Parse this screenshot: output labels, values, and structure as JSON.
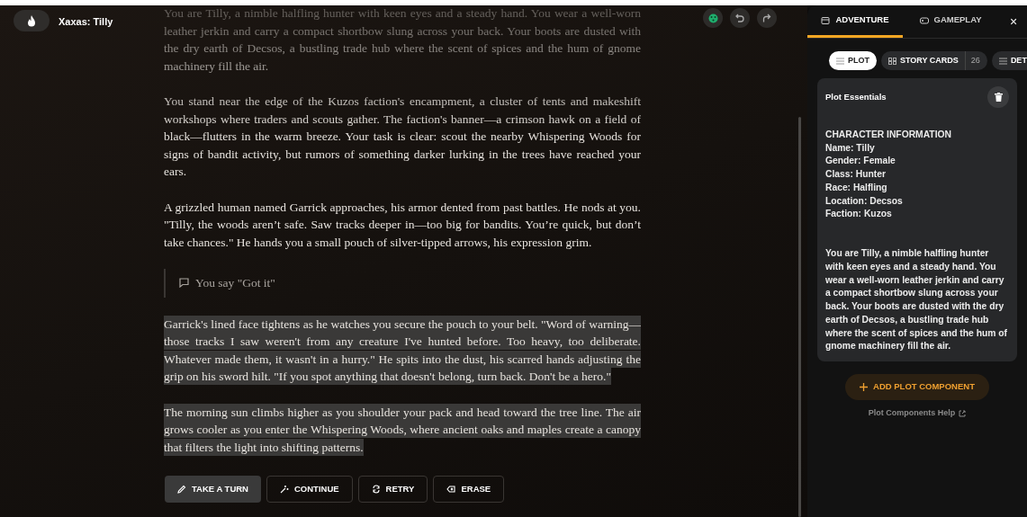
{
  "header": {
    "title": "Xaxas: Tilly"
  },
  "story": [
    {
      "kind": "narration",
      "highlighted": false,
      "text": "You are Tilly, a nimble halfling hunter with keen eyes and a steady hand. You wear a well-worn leather jerkin and carry a compact shortbow slung across your back. Your boots are dusted with the dry earth of Decsos, a bustling trade hub where the scent of spices and the hum of gnome machinery fill the air."
    },
    {
      "kind": "narration",
      "highlighted": false,
      "text": "You stand near the edge of the Kuzos faction's encampment, a cluster of tents and makeshift workshops where traders and scouts gather. The faction's banner—a crimson hawk on a field of black—flutters in the warm breeze. Your task is clear: scout the nearby Whispering Woods for signs of bandit activity, but rumors of something darker lurking in the trees have reached your ears."
    },
    {
      "kind": "narration",
      "highlighted": false,
      "text": "A grizzled human named Garrick approaches, his armor dented from past battles. He nods at you. \"Tilly, the woods aren’t safe. Saw tracks deeper in—too big for bandits. You’re quick, but don’t take chances.\" He hands you a small pouch of silver-tipped arrows, his expression grim."
    },
    {
      "kind": "action",
      "highlighted": false,
      "text": "You say \"Got it\""
    },
    {
      "kind": "narration",
      "highlighted": true,
      "text": "Garrick's lined face tightens as he watches you secure the pouch to your belt. \"Word of warning—those tracks I saw weren't from any creature I've hunted before. Too heavy, too deliberate. Whatever made them, it wasn't in a hurry.\" He spits into the dust, his scarred hands adjusting the grip on his sword hilt. \"If you spot anything that doesn't belong, turn back. Don't be a hero.\""
    },
    {
      "kind": "narration",
      "highlighted": true,
      "text": "The morning sun climbs higher as you shoulder your pack and head toward the tree line. The air grows cooler as you enter the Whispering Woods, where ancient oaks and maples create a canopy that filters the light into shifting patterns."
    }
  ],
  "actions": [
    {
      "label": "TAKE A TURN",
      "selected": true
    },
    {
      "label": "CONTINUE",
      "selected": false
    },
    {
      "label": "RETRY",
      "selected": false
    },
    {
      "label": "ERASE",
      "selected": false
    }
  ],
  "panel": {
    "tabs": [
      {
        "label": "ADVENTURE",
        "selected": true
      },
      {
        "label": "GAMEPLAY",
        "selected": false
      }
    ],
    "close": "×",
    "pills": [
      {
        "label": "PLOT",
        "selected": true
      },
      {
        "label": "STORY CARDS",
        "count": "26",
        "selected": false
      },
      {
        "label": "DET",
        "selected": false
      }
    ],
    "card": {
      "title": "Plot Essentials",
      "text": "CHARACTER INFORMATION\nName: Tilly\nGender: Female\nClass: Hunter\nRace: Halfling\nLocation: Decsos\nFaction: Kuzos\n\n\nYou are Tilly, a nimble halfling hunter with keen eyes and a steady hand. You wear a well-worn leather jerkin and carry a compact shortbow slung across your back. Your boots are dusted with the dry earth of Decsos, a bustling trade hub where the scent of spices and the hum of gnome machinery fill the air."
    },
    "add_button": "ADD PLOT COMPONENT",
    "help_link": "Plot Components Help"
  }
}
